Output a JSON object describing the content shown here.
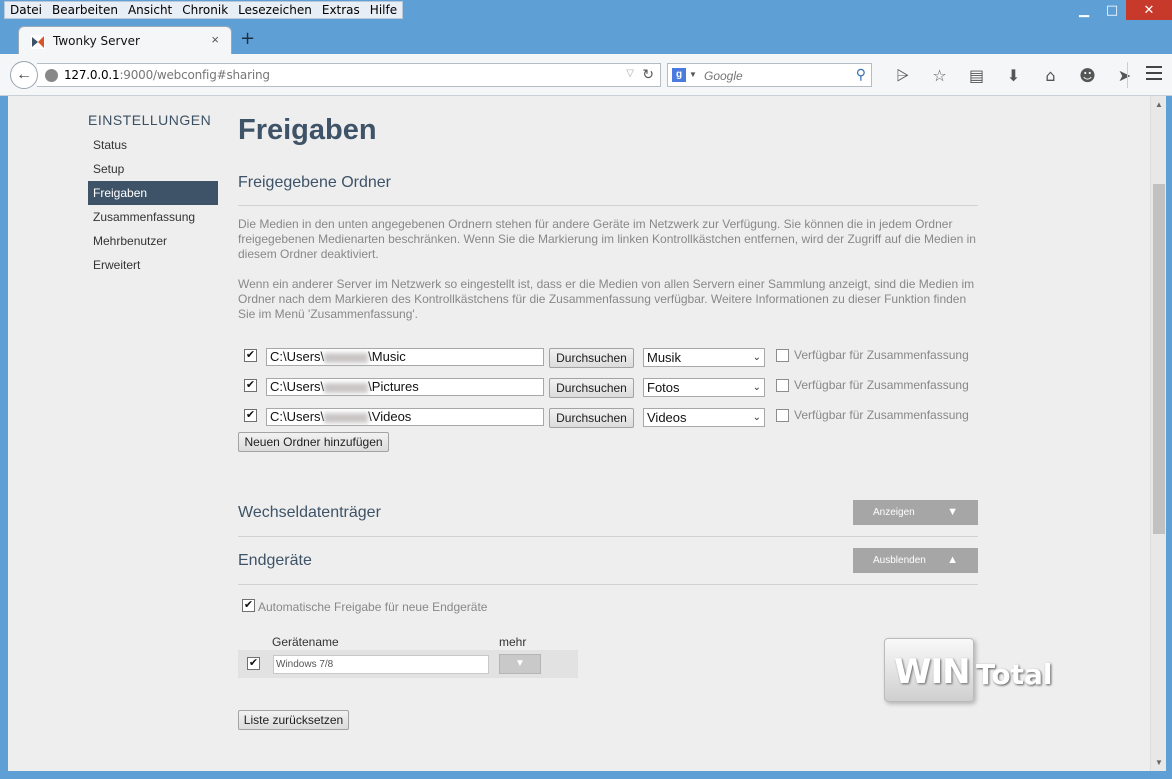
{
  "menubar": [
    "Datei",
    "Bearbeiten",
    "Ansicht",
    "Chronik",
    "Lesezeichen",
    "Extras",
    "Hilfe"
  ],
  "window_controls": {
    "minimize": "▁",
    "maximize": "□",
    "close": "✕"
  },
  "tab": {
    "title": "Twonky Server",
    "close": "×",
    "new_tab": "+"
  },
  "navbar": {
    "url_host": "127.0.0.1",
    "url_rest": ":9000/webconfig#sharing",
    "search_placeholder": "Google",
    "search_engine_letter": "g"
  },
  "sidebar": {
    "title": "EINSTELLUNGEN",
    "items": [
      "Status",
      "Setup",
      "Freigaben",
      "Zusammenfassung",
      "Mehrbenutzer",
      "Erweitert"
    ],
    "active": "Freigaben"
  },
  "main": {
    "title": "Freigaben",
    "shared_folders": {
      "heading": "Freigegebene Ordner",
      "para1": "Die Medien in den unten angegebenen Ordnern stehen für andere Geräte im Netzwerk zur Verfügung. Sie können die in jedem Ordner freigegebenen Medienarten beschränken. Wenn Sie die Markierung im linken Kontrollkästchen entfernen, wird der Zugriff auf die Medien in diesem Ordner deaktiviert.",
      "para2": "Wenn ein anderer Server im Netzwerk so eingestellt ist, dass er die Medien von allen Servern einer Sammlung anzeigt, sind die Medien im Ordner nach dem Markieren des Kontrollkästchens für die Zusammenfassung verfügbar. Weitere Informationen zu dieser Funktion finden Sie im Menü 'Zusammenfassung'.",
      "folders": [
        {
          "prefix": "C:\\Users\\",
          "suffix": "\\Music",
          "type": "Musik",
          "checked": true,
          "aggregate": false
        },
        {
          "prefix": "C:\\Users\\",
          "suffix": "\\Pictures",
          "type": "Fotos",
          "checked": true,
          "aggregate": false
        },
        {
          "prefix": "C:\\Users\\",
          "suffix": "\\Videos",
          "type": "Videos",
          "checked": true,
          "aggregate": false
        }
      ],
      "browse_label": "Durchsuchen",
      "aggregate_label": "Verfügbar für Zusammenfassung",
      "add_folder_label": "Neuen Ordner hinzufügen"
    },
    "removable": {
      "heading": "Wechseldatenträger",
      "toggle_label": "Anzeigen"
    },
    "devices": {
      "heading": "Endgeräte",
      "toggle_label": "Ausblenden",
      "auto_share_label": "Automatische Freigabe für neue Endgeräte",
      "auto_share_checked": true,
      "col_name": "Gerätename",
      "col_more": "mehr",
      "rows": [
        {
          "name": "Windows 7/8",
          "checked": true
        }
      ],
      "reset_label": "Liste zurücksetzen"
    }
  },
  "watermark": {
    "part1": "WIN",
    "part2": "Total"
  },
  "colors": {
    "accent": "#3e5367",
    "window_frame": "#5ea0d6",
    "close_red": "#c7392b"
  }
}
